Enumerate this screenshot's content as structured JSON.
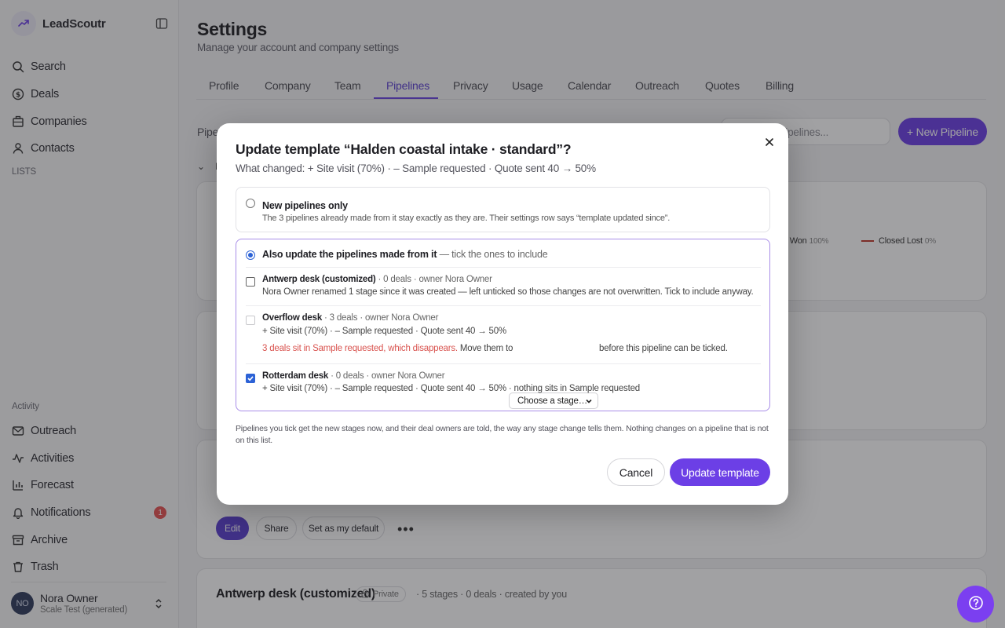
{
  "app": {
    "name": "LeadScoutr"
  },
  "sidebar": {
    "nav": [
      {
        "label": "Search",
        "icon": "search-icon"
      },
      {
        "label": "Deals",
        "icon": "dollar-circle-icon"
      },
      {
        "label": "Companies",
        "icon": "building-icon"
      },
      {
        "label": "Contacts",
        "icon": "person-icon"
      }
    ],
    "lists_label": "LISTS",
    "activity_label": "Activity",
    "activity": [
      {
        "label": "Outreach",
        "icon": "mail-icon"
      },
      {
        "label": "Activities",
        "icon": "activity-icon"
      },
      {
        "label": "Forecast",
        "icon": "bar-chart-icon"
      },
      {
        "label": "Notifications",
        "icon": "bell-icon",
        "badge": "1"
      },
      {
        "label": "Archive",
        "icon": "archive-icon"
      },
      {
        "label": "Trash",
        "icon": "trash-icon"
      }
    ],
    "user": {
      "initials": "NO",
      "name": "Nora Owner",
      "org": "Scale Test (generated)"
    }
  },
  "header": {
    "title": "Settings",
    "subtitle": "Manage your account and company settings",
    "tabs": [
      "Profile",
      "Company",
      "Team",
      "Pipelines",
      "Privacy",
      "Usage",
      "Calendar",
      "Outreach",
      "Quotes",
      "Billing"
    ],
    "active_tab": "Pipelines"
  },
  "background": {
    "pipelines_label": "Pipel",
    "search_placeholder": "pipelines...",
    "new_pipeline": "+ New Pipeline",
    "collapse_label": "N",
    "stage_won": {
      "label": "d Won",
      "pct": "100%"
    },
    "stage_lost": {
      "label": "Closed Lost",
      "pct": "0%"
    },
    "actions": {
      "edit": "Edit",
      "share": "Share",
      "default": "Set as my default",
      "more": "•••"
    },
    "card_title": "Antwerp desk (customized)",
    "private_label": "Private",
    "card_meta": "· 5 stages · 0 deals · created by you"
  },
  "modal": {
    "title": "Update template “Halden coastal intake · standard”?",
    "subtitle": "What changed: + Site visit (70%) · – Sample requested · Quote sent 40 → 50%",
    "option_new": {
      "title": "New pipelines only",
      "desc": "The 3 pipelines already made from it stay exactly as they are. Their settings row says “template updated since”."
    },
    "option_also": {
      "title": "Also update the pipelines made from it",
      "hint": " — tick the ones to include"
    },
    "pipelines": [
      {
        "name": "Antwerp desk (customized)",
        "meta": " · 0 deals · owner Nora Owner",
        "line2": "Nora Owner renamed 1 stage since it was created — left unticked so those changes are not overwritten. Tick to include anyway."
      },
      {
        "name": "Overflow desk",
        "meta": " · 3 deals · owner Nora Owner",
        "line2": "+ Site visit (70%) · – Sample requested · Quote sent 40 → 50%",
        "warning": "3 deals sit in Sample requested, which disappears.",
        "move_prefix": " Move them to",
        "select_value": "Choose a stage…",
        "move_suffix": "before this pipeline can be ticked."
      },
      {
        "name": "Rotterdam desk",
        "meta": " · 0 deals · owner Nora Owner",
        "line2": "+ Site visit (70%) · – Sample requested · Quote sent 40 → 50% · nothing sits in Sample requested"
      }
    ],
    "footer_note": "Pipelines you tick get the new stages now, and their deal owners are told, the way any stage change tells them. Nothing changes on a pipeline that is not on this list.",
    "cancel": "Cancel",
    "confirm": "Update template"
  },
  "colors": {
    "accent": "#6c3fe6",
    "warning": "#d9534f",
    "checkbox": "#2c62d6"
  }
}
